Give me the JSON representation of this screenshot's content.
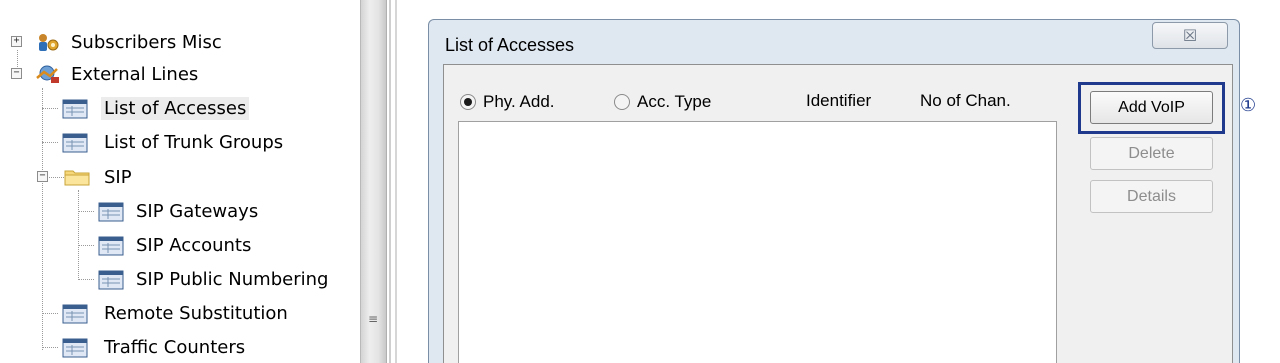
{
  "tree": {
    "items": [
      {
        "label": "Subscribers Misc",
        "icon": "gear-person-icon",
        "expander": "+"
      },
      {
        "label": "External Lines",
        "icon": "network-icon",
        "expander": "−"
      },
      {
        "label": "List of Accesses",
        "icon": "table-window-icon"
      },
      {
        "label": "List of Trunk Groups",
        "icon": "table-window-icon"
      },
      {
        "label": "SIP",
        "icon": "folder-icon",
        "expander": "−"
      },
      {
        "label": "SIP Gateways",
        "icon": "table-window-icon"
      },
      {
        "label": "SIP Accounts",
        "icon": "table-window-icon"
      },
      {
        "label": "SIP Public Numbering",
        "icon": "table-window-icon"
      },
      {
        "label": "Remote Substitution",
        "icon": "table-window-icon"
      },
      {
        "label": "Traffic Counters",
        "icon": "table-window-icon"
      }
    ]
  },
  "splitter": {
    "grip": "≡"
  },
  "dialog": {
    "title": "List of Accesses",
    "close_glyph": "☒",
    "columns": [
      {
        "label": "Phy. Add.",
        "radio": true,
        "selected": true
      },
      {
        "label": "Acc. Type",
        "radio": true,
        "selected": false
      },
      {
        "label": "Identifier"
      },
      {
        "label": "No of Chan."
      }
    ],
    "buttons": {
      "add_voip": "Add VoIP",
      "delete": "Delete",
      "details": "Details"
    }
  },
  "callout": {
    "marker": "①"
  },
  "colors": {
    "highlight": "#1f3a8c",
    "selected_bg": "#ececec"
  }
}
